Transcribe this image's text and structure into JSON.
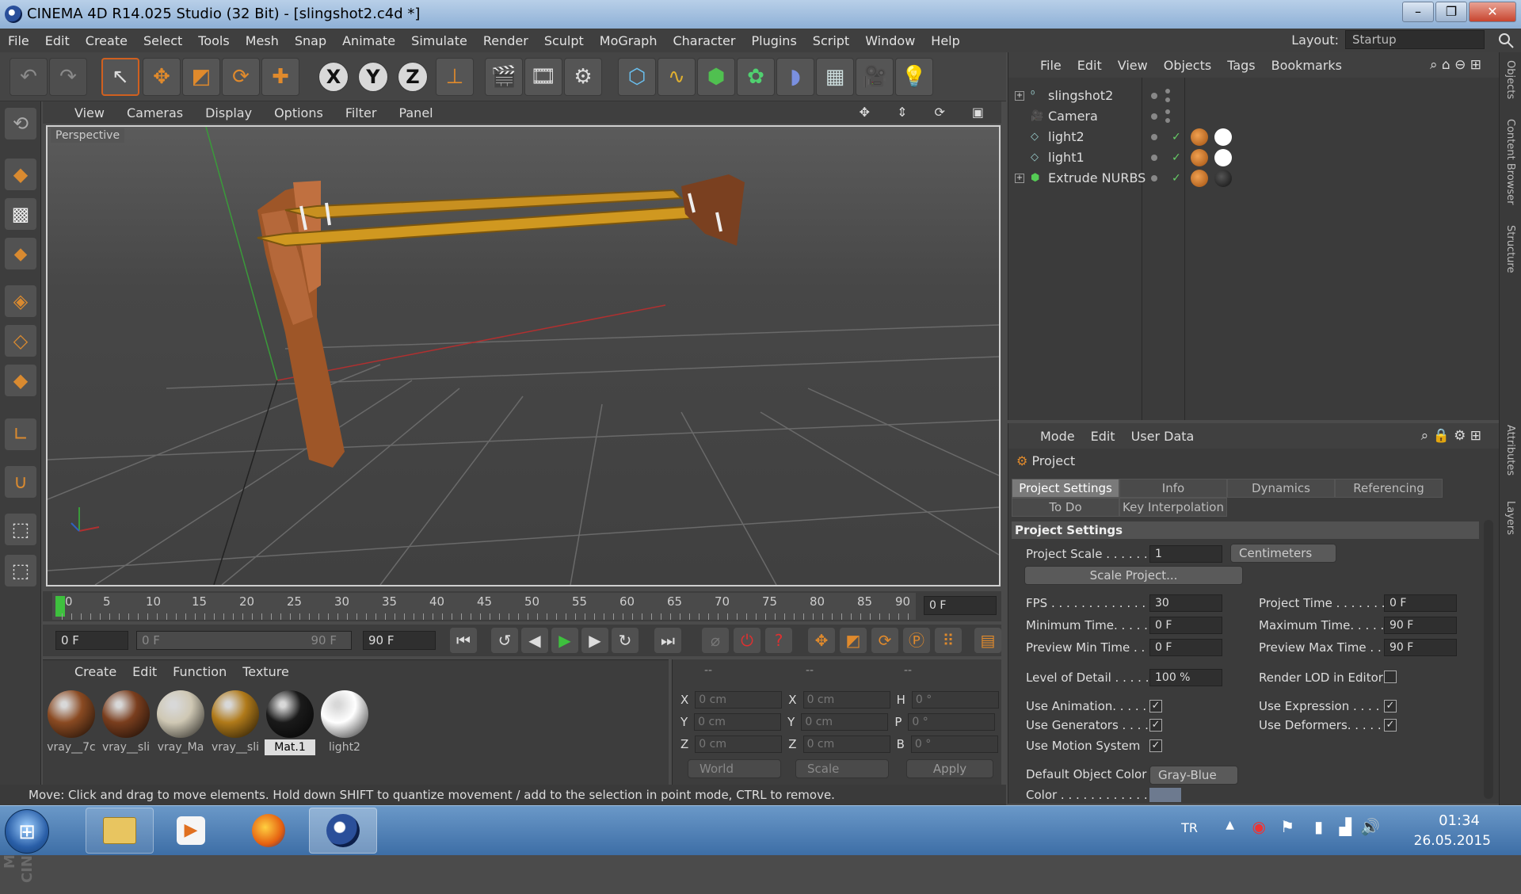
{
  "window": {
    "title": "CINEMA 4D R14.025 Studio (32 Bit) - [slingshot2.c4d *]",
    "minimize": "–",
    "maximize": "❐",
    "close": "✕"
  },
  "menu": [
    "File",
    "Edit",
    "Create",
    "Select",
    "Tools",
    "Mesh",
    "Snap",
    "Animate",
    "Simulate",
    "Render",
    "Sculpt",
    "MoGraph",
    "Character",
    "Plugins",
    "Script",
    "Window",
    "Help"
  ],
  "layout": {
    "label": "Layout:",
    "value": "Startup"
  },
  "viewport": {
    "menu": [
      "View",
      "Cameras",
      "Display",
      "Options",
      "Filter",
      "Panel"
    ],
    "label": "Perspective"
  },
  "timeline": {
    "ticks": [
      "0",
      "5",
      "10",
      "15",
      "20",
      "25",
      "30",
      "35",
      "40",
      "45",
      "50",
      "55",
      "60",
      "65",
      "70",
      "75",
      "80",
      "85",
      "90"
    ],
    "current": "0 F"
  },
  "transport": {
    "start": "0 F",
    "range_start": "0 F",
    "range_end": "90 F",
    "end": "90 F"
  },
  "materials": {
    "menu": [
      "Create",
      "Edit",
      "Function",
      "Texture"
    ],
    "items": [
      {
        "label": "vray__7c",
        "color": "#8a4a22"
      },
      {
        "label": "vray__sli",
        "color": "#7a3e1e"
      },
      {
        "label": "vray_Ma",
        "color": "#cfc8b4"
      },
      {
        "label": "vray__sli",
        "color": "#b07a1a"
      },
      {
        "label": "Mat.1",
        "color": "#1a1a1a"
      },
      {
        "label": "light2",
        "color": "#ffffff"
      }
    ]
  },
  "coords": {
    "headers": [
      "--",
      "--",
      "--"
    ],
    "rows": [
      {
        "a": "X",
        "av": "0 cm",
        "b": "X",
        "bv": "0 cm",
        "c": "H",
        "cv": "0 °"
      },
      {
        "a": "Y",
        "av": "0 cm",
        "b": "Y",
        "bv": "0 cm",
        "c": "P",
        "cv": "0 °"
      },
      {
        "a": "Z",
        "av": "0 cm",
        "b": "Z",
        "bv": "0 cm",
        "c": "B",
        "cv": "0 °"
      }
    ],
    "world": "World",
    "scale": "Scale",
    "apply": "Apply"
  },
  "status": "Move: Click and drag to move elements. Hold down SHIFT to quantize movement / add to the selection in point mode, CTRL to remove.",
  "objects": {
    "menu": [
      "File",
      "Edit",
      "View",
      "Objects",
      "Tags",
      "Bookmarks"
    ],
    "items": [
      {
        "name": "slingshot2",
        "icon": "null-icon"
      },
      {
        "name": "Camera",
        "icon": "camera-icon"
      },
      {
        "name": "light2",
        "icon": "light-icon"
      },
      {
        "name": "light1",
        "icon": "light-icon"
      },
      {
        "name": "Extrude NURBS",
        "icon": "extrude-icon"
      }
    ]
  },
  "attributes": {
    "menu": [
      "Mode",
      "Edit",
      "User Data"
    ],
    "title": "Project",
    "tabs": [
      "Project Settings",
      "Info",
      "Dynamics",
      "Referencing",
      "To Do",
      "Key Interpolation"
    ],
    "section": "Project Settings",
    "project_scale": {
      "label": "Project Scale . . . . . .",
      "value": "1",
      "unit": "Centimeters"
    },
    "scale_button": "Scale Project...",
    "fps": {
      "label": "FPS . . . . . . . . . . . . .",
      "value": "30"
    },
    "project_time": {
      "label": "Project Time . . . . . . .",
      "value": "0 F"
    },
    "min_time": {
      "label": "Minimum Time. . . . . .",
      "value": "0 F"
    },
    "max_time": {
      "label": "Maximum Time. . . . . .",
      "value": "90 F"
    },
    "prev_min": {
      "label": "Preview Min Time . . .",
      "value": "0 F"
    },
    "prev_max": {
      "label": "Preview Max Time . . .",
      "value": "90 F"
    },
    "lod": {
      "label": "Level of Detail . . . . .",
      "value": "100 %"
    },
    "render_lod": "Render LOD in Editor",
    "use_animation": "Use Animation. . . . .",
    "use_expression": "Use Expression . . . . .",
    "use_generators": "Use Generators . . . .",
    "use_deformers": "Use Deformers. . . . .",
    "use_motion": "Use Motion System",
    "default_color": {
      "label": "Default Object Color",
      "value": "Gray-Blue"
    },
    "color": "Color . . . . . . . . . . . ."
  },
  "side_tabs": [
    "Objects",
    "Content Browser",
    "Structure",
    "Attributes",
    "Layers"
  ],
  "taskbar": {
    "lang": "TR",
    "time": "01:34",
    "date": "26.05.2015"
  }
}
